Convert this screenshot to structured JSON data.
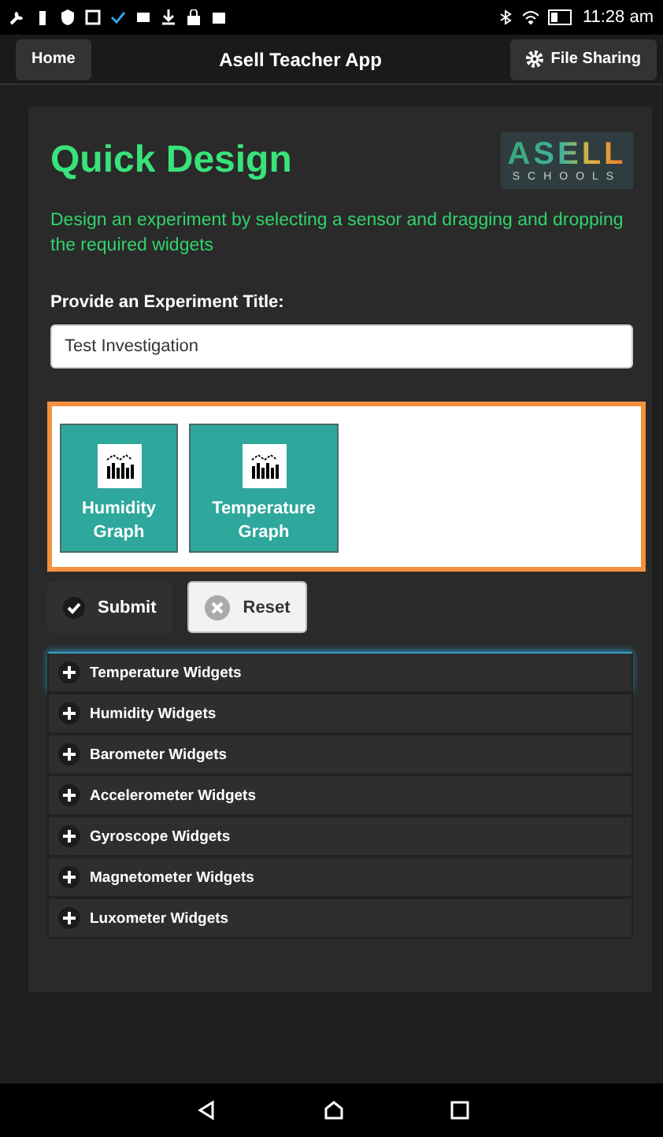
{
  "status_bar": {
    "time": "11:28 am"
  },
  "header": {
    "home": "Home",
    "title": "Asell Teacher App",
    "file_sharing": "File Sharing"
  },
  "page": {
    "title": "Quick Design",
    "logo": {
      "word": "ASELL",
      "sub": "SCHOOLS"
    },
    "description": "Design an experiment by selecting a sensor and dragging and dropping the required widgets",
    "title_label": "Provide an Experiment Title:",
    "title_value": "Test Investigation"
  },
  "dropped_widgets": [
    {
      "label": "Humidity Graph"
    },
    {
      "label": "Temperature Graph"
    }
  ],
  "buttons": [
    {
      "kind": "submit",
      "label": "Submit"
    },
    {
      "kind": "reset",
      "label": "Reset"
    }
  ],
  "accordion": [
    {
      "label": "Temperature Widgets",
      "expanded": false,
      "focused": true
    },
    {
      "label": "Humidity Widgets",
      "expanded": false,
      "focused": false
    },
    {
      "label": "Barometer Widgets",
      "expanded": false,
      "focused": false
    },
    {
      "label": "Accelerometer Widgets",
      "expanded": false,
      "focused": false
    },
    {
      "label": "Gyroscope Widgets",
      "expanded": false,
      "focused": false
    },
    {
      "label": "Magnetometer Widgets",
      "expanded": false,
      "focused": false
    },
    {
      "label": "Luxometer Widgets",
      "expanded": false,
      "focused": false
    }
  ]
}
